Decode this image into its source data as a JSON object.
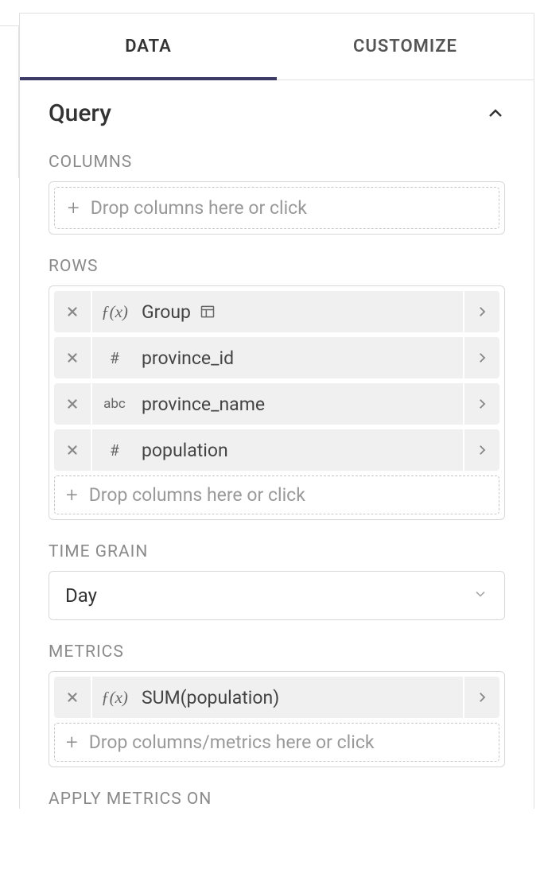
{
  "tabs": {
    "data": "DATA",
    "customize": "CUSTOMIZE"
  },
  "section": {
    "title": "Query"
  },
  "columns": {
    "label": "COLUMNS",
    "placeholder": "Drop columns here or click"
  },
  "rows": {
    "label": "ROWS",
    "items": [
      {
        "type": "fx",
        "type_display": "ƒ(x)",
        "label": "Group",
        "has_extra_icon": true
      },
      {
        "type": "num",
        "type_display": "#",
        "label": "province_id"
      },
      {
        "type": "abc",
        "type_display": "abc",
        "label": "province_name"
      },
      {
        "type": "num",
        "type_display": "#",
        "label": "population"
      }
    ],
    "placeholder": "Drop columns here or click"
  },
  "time_grain": {
    "label": "TIME GRAIN",
    "value": "Day"
  },
  "metrics": {
    "label": "METRICS",
    "items": [
      {
        "type": "fx",
        "type_display": "ƒ(x)",
        "label": "SUM(population)"
      }
    ],
    "placeholder": "Drop columns/metrics here or click"
  },
  "apply_metrics": {
    "label": "APPLY METRICS ON"
  }
}
